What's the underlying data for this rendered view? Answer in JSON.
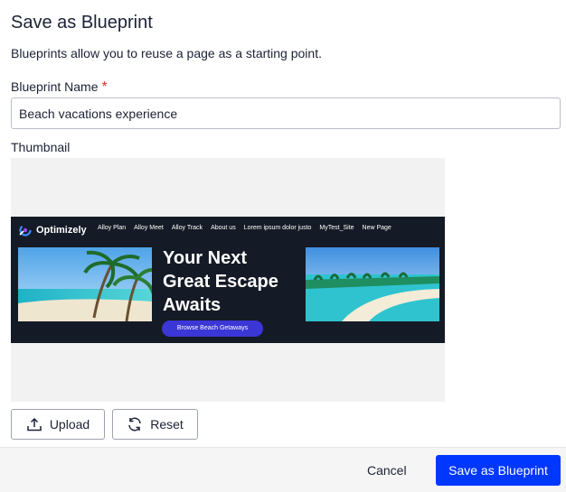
{
  "dialog": {
    "title": "Save as Blueprint",
    "description": "Blueprints allow you to reuse a page as a starting point.",
    "name_label": "Blueprint Name",
    "required_marker": "*",
    "name_value": "Beach vacations experience",
    "thumbnail_label": "Thumbnail",
    "upload_label": "Upload",
    "reset_label": "Reset"
  },
  "thumbnail": {
    "brand": "Optimizely",
    "nav_items": [
      "Alloy Plan",
      "Alloy Meet",
      "Alloy Track",
      "About us",
      "Lorem ipsum dolor justo",
      "MyTest_Site",
      "New Page"
    ],
    "headline": "Your Next Great Escape Awaits",
    "cta_label": "Browse Beach Getaways"
  },
  "footer": {
    "cancel_label": "Cancel",
    "save_label": "Save as Blueprint"
  },
  "colors": {
    "primary": "#0037ff",
    "required": "#d9322b",
    "banner_bg": "#151b26",
    "cta": "#3b36d6"
  },
  "icons": {
    "upload": "upload-icon",
    "reset": "refresh-icon"
  }
}
